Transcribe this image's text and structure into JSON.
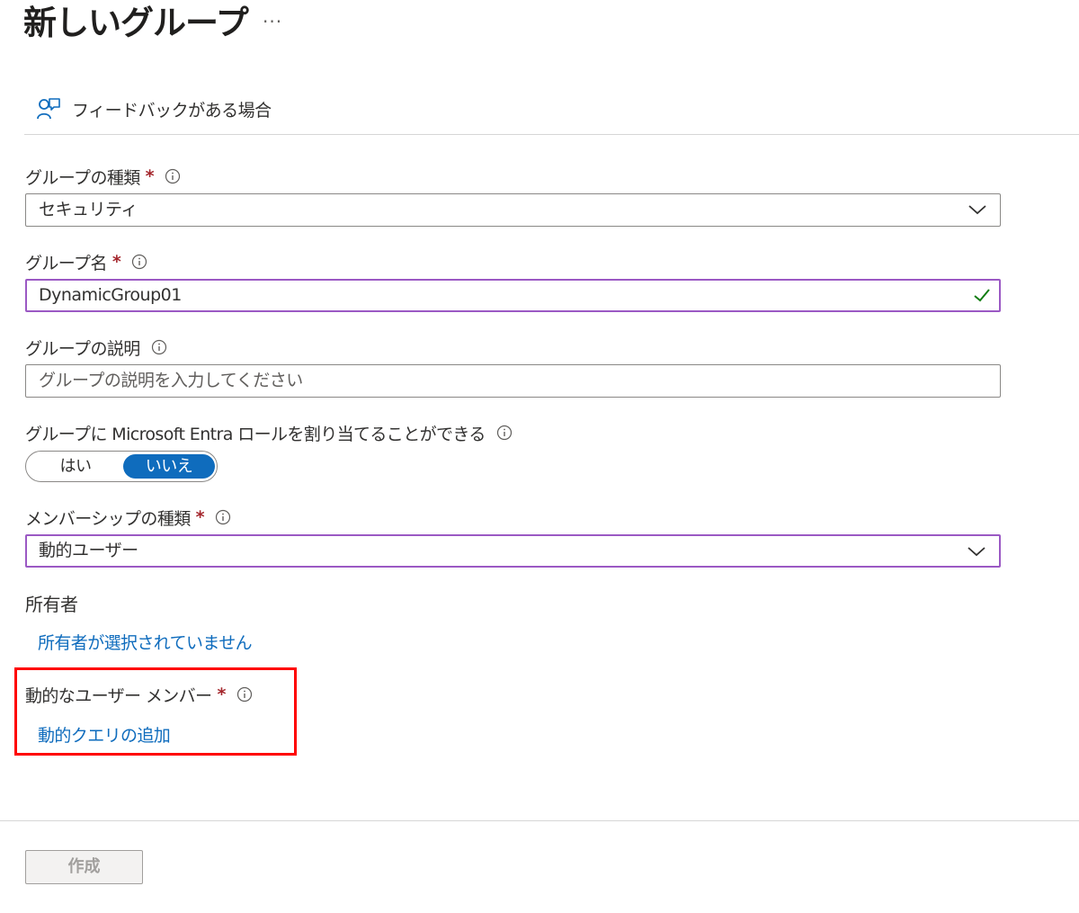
{
  "header": {
    "title": "新しいグループ",
    "more_label": "···"
  },
  "toolbar": {
    "feedback_label": "フィードバックがある場合"
  },
  "form": {
    "group_type": {
      "label": "グループの種類",
      "required": "*",
      "value": "セキュリティ"
    },
    "group_name": {
      "label": "グループ名",
      "required": "*",
      "value": "DynamicGroup01"
    },
    "group_description": {
      "label": "グループの説明",
      "placeholder": "グループの説明を入力してください"
    },
    "entra_roles": {
      "label": "グループに Microsoft Entra ロールを割り当てることができる",
      "yes_label": "はい",
      "no_label": "いいえ",
      "selected": "いいえ"
    },
    "membership_type": {
      "label": "メンバーシップの種類",
      "required": "*",
      "value": "動的ユーザー"
    },
    "owners": {
      "label": "所有者",
      "link": "所有者が選択されていません"
    },
    "dynamic_members": {
      "label": "動的なユーザー メンバー",
      "required": "*",
      "link": "動的クエリの追加"
    }
  },
  "footer": {
    "create_label": "作成"
  },
  "colors": {
    "accent": "#0f6cbd",
    "required": "#a4262c",
    "focus_border": "#9b59c4",
    "valid_check": "#107c10",
    "highlight": "#ff0000"
  },
  "icons": {
    "feedback": "person-feedback-icon",
    "info": "info-icon",
    "chevron": "chevron-down-icon",
    "check": "checkmark-icon"
  }
}
